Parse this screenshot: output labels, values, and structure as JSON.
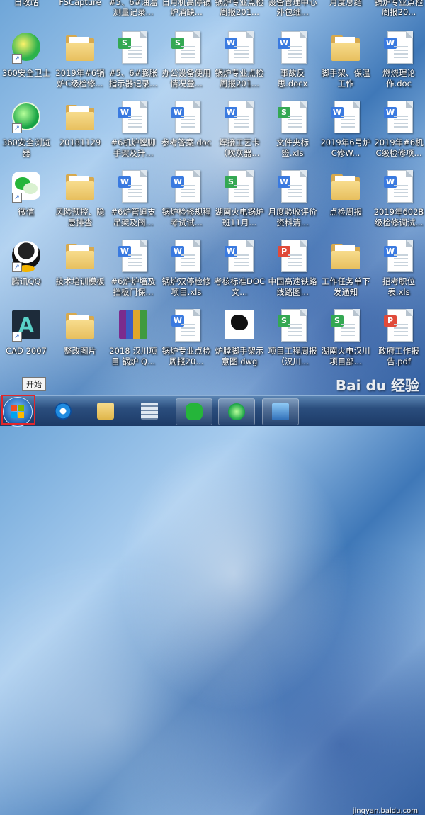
{
  "desktop": {
    "top_row_partial": [
      "日收站",
      "FSCapture",
      "#5、6#油温测量记录...",
      "日月机高停锅炉消缺...",
      "锅炉专业点检周报201...",
      "设备管理中心外包维...",
      "月度总结",
      "锅炉专业点检周报20..."
    ],
    "icons": [
      [
        "360安全卫士",
        "2019年#6锅炉C级检修...",
        "#5、6#膨胀指示器记录...",
        "办公设备使用情况登...",
        "锅炉专业点检周报201...",
        "事故反思.docx",
        "脚手架、保温工作",
        "燃烧理论作.doc"
      ],
      [
        "360安全浏览器",
        "20181129",
        "#6机炉膛脚手架及升...",
        "参考答案.doc",
        "焊接工艺卡（吹灰器...",
        "文件夹标签.xls",
        "2019年6号炉C修W...",
        "2019年#6机C级检修项..."
      ],
      [
        "微信",
        "风险预控、隐患排查",
        "#6炉管道支吊架及阀...",
        "锅炉检修规程考试试...",
        "湖南火电锅炉班11月...",
        "月度验收评价资料清...",
        "点检周报",
        "2019年602B级检修调试..."
      ],
      [
        "腾讯QQ",
        "技术培训模板",
        "#6炉炉墙及挡板门保...",
        "锅炉双停检修项目.xls",
        "考核标准DOC文...",
        "中国高速铁路线路图...",
        "工作任务单下发通知",
        "招考职位表.xls"
      ],
      [
        "CAD 2007",
        "整改图片",
        "2018 汉川项目 锅炉 Q...",
        "锅炉专业点检周报20...",
        "炉膛脚手架示意图.dwg",
        "项目工程周报（汉川...",
        "湖南火电汉川项目部...",
        "政府工作报告.pdf"
      ]
    ],
    "icon_kinds": [
      [
        "app-360",
        "folder",
        "sheet",
        "sheet",
        "word",
        "word",
        "folder",
        "word"
      ],
      [
        "app-360browser",
        "folder",
        "word",
        "word",
        "word",
        "sheet",
        "word",
        "word"
      ],
      [
        "app-wechat",
        "folder",
        "word",
        "word",
        "sheet",
        "word",
        "folder",
        "word"
      ],
      [
        "app-qq",
        "folder",
        "word",
        "word",
        "word",
        "pdf",
        "folder",
        "word"
      ],
      [
        "app-cad",
        "folder",
        "archive",
        "word",
        "dwg",
        "sheet",
        "sheet",
        "pdf"
      ]
    ]
  },
  "tooltip": {
    "start": "开始"
  },
  "watermark": {
    "brand": "Bai du 经验",
    "url": "jingyan.baidu.com"
  },
  "taskbar": {
    "buttons": [
      "start-button",
      "internet-explorer",
      "file-explorer",
      "calculator",
      "wechat",
      "360-browser",
      "desktop-preview"
    ]
  },
  "colors": {
    "highlight": "#e2262b",
    "word": "#3a7ae0",
    "sheet": "#34a853",
    "pdf": "#e04a3a"
  }
}
